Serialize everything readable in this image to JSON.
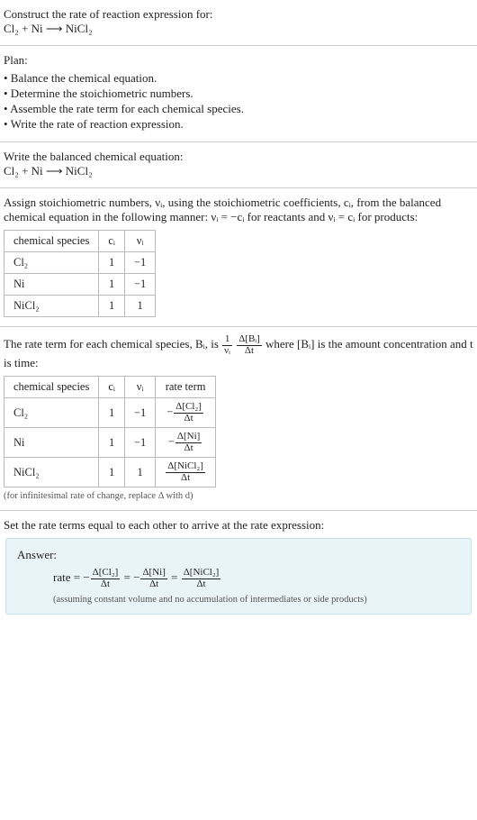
{
  "header": {
    "prompt": "Construct the rate of reaction expression for:",
    "equation": "Cl₂ + Ni ⟶ NiCl₂"
  },
  "plan": {
    "title": "Plan:",
    "items": [
      "• Balance the chemical equation.",
      "• Determine the stoichiometric numbers.",
      "• Assemble the rate term for each chemical species.",
      "• Write the rate of reaction expression."
    ]
  },
  "balanced": {
    "intro": "Write the balanced chemical equation:",
    "equation": "Cl₂ + Ni ⟶ NiCl₂"
  },
  "stoich": {
    "intro_a": "Assign stoichiometric numbers, νᵢ, using the stoichiometric coefficients, cᵢ, from the balanced chemical equation in the following manner: νᵢ = −cᵢ for reactants and νᵢ = cᵢ for products:",
    "headers": {
      "sp": "chemical species",
      "c": "cᵢ",
      "v": "νᵢ"
    },
    "rows": [
      {
        "sp": "Cl₂",
        "c": "1",
        "v": "−1"
      },
      {
        "sp": "Ni",
        "c": "1",
        "v": "−1"
      },
      {
        "sp": "NiCl₂",
        "c": "1",
        "v": "1"
      }
    ]
  },
  "rate_terms": {
    "intro_a": "The rate term for each chemical species, Bᵢ, is ",
    "intro_b": " where [Bᵢ] is the amount concentration and t is time:",
    "headers": {
      "sp": "chemical species",
      "c": "cᵢ",
      "v": "νᵢ",
      "rt": "rate term"
    },
    "rows": [
      {
        "sp": "Cl₂",
        "c": "1",
        "v": "−1"
      },
      {
        "sp": "Ni",
        "c": "1",
        "v": "−1"
      },
      {
        "sp": "NiCl₂",
        "c": "1",
        "v": "1"
      }
    ],
    "note": "(for infinitesimal rate of change, replace Δ with d)"
  },
  "final": {
    "intro": "Set the rate terms equal to each other to arrive at the rate expression:",
    "answer_label": "Answer:",
    "rate_label": "rate = ",
    "note": "(assuming constant volume and no accumulation of intermediates or side products)"
  },
  "chart_data": {
    "type": "table",
    "tables": [
      {
        "title": "stoichiometric numbers",
        "columns": [
          "chemical species",
          "c_i",
          "nu_i"
        ],
        "rows": [
          [
            "Cl2",
            1,
            -1
          ],
          [
            "Ni",
            1,
            -1
          ],
          [
            "NiCl2",
            1,
            1
          ]
        ]
      },
      {
        "title": "rate terms",
        "columns": [
          "chemical species",
          "c_i",
          "nu_i",
          "rate term"
        ],
        "rows": [
          [
            "Cl2",
            1,
            -1,
            "-Δ[Cl2]/Δt"
          ],
          [
            "Ni",
            1,
            -1,
            "-Δ[Ni]/Δt"
          ],
          [
            "NiCl2",
            1,
            1,
            "Δ[NiCl2]/Δt"
          ]
        ]
      }
    ],
    "rate_expression": "rate = -Δ[Cl2]/Δt = -Δ[Ni]/Δt = Δ[NiCl2]/Δt"
  }
}
